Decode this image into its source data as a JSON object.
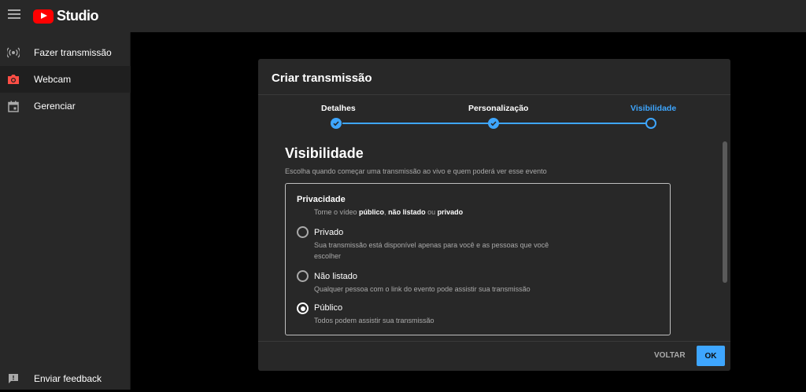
{
  "app": {
    "logo_text": "Studio",
    "brand_color": "#ff0000",
    "accent_color": "#3ea6ff"
  },
  "sidebar": {
    "items": [
      {
        "label": "Fazer transmissão",
        "icon": "broadcast-icon"
      },
      {
        "label": "Webcam",
        "icon": "camera-icon",
        "active": true
      },
      {
        "label": "Gerenciar",
        "icon": "calendar-icon"
      }
    ],
    "feedback_label": "Enviar feedback"
  },
  "dialog": {
    "title": "Criar transmissão",
    "steps": [
      {
        "label": "Detalhes",
        "state": "done"
      },
      {
        "label": "Personalização",
        "state": "done"
      },
      {
        "label": "Visibilidade",
        "state": "current"
      }
    ],
    "section_title": "Visibilidade",
    "section_desc": "Escolha quando começar uma transmissão ao vivo e quem poderá ver esse evento",
    "privacy": {
      "title": "Privacidade",
      "sub_prefix": "Torne o vídeo ",
      "sub_public": "público",
      "sub_sep": ", ",
      "sub_unlisted": "não listado",
      "sub_or": " ou ",
      "sub_private": "privado",
      "options": [
        {
          "label": "Privado",
          "desc": "Sua transmissão está disponível apenas para você e as pessoas que você escolher",
          "selected": false
        },
        {
          "label": "Não listado",
          "desc": "Qualquer pessoa com o link do evento pode assistir sua transmissão",
          "selected": false
        },
        {
          "label": "Público",
          "desc": "Todos podem assistir sua transmissão",
          "selected": true
        }
      ]
    },
    "back_label": "VOLTAR",
    "ok_label": "OK"
  }
}
